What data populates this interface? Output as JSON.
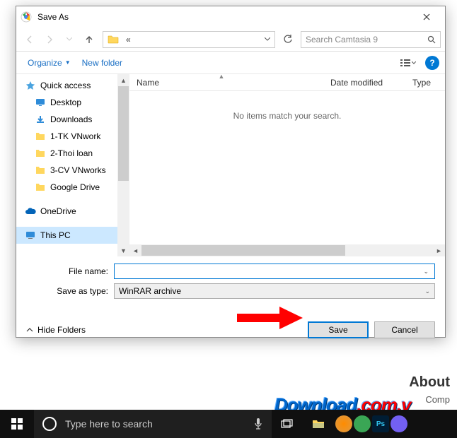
{
  "dialog": {
    "title": "Save As",
    "path_display": "«",
    "search_placeholder": "Search Camtasia 9",
    "organize_label": "Organize",
    "new_folder_label": "New folder",
    "columns": {
      "name": "Name",
      "date": "Date modified",
      "type": "Type"
    },
    "empty_message": "No items match your search.",
    "file_name_label": "File name:",
    "file_name_value": "",
    "save_type_label": "Save as type:",
    "save_type_value": "WinRAR archive",
    "hide_folders_label": "Hide Folders",
    "save_button": "Save",
    "cancel_button": "Cancel"
  },
  "nav_tree": {
    "quick_access": "Quick access",
    "desktop": "Desktop",
    "downloads": "Downloads",
    "item1": "1-TK VNwork",
    "item2": "2-Thoi loan",
    "item3": "3-CV VNworks",
    "item4": "Google Drive",
    "onedrive": "OneDrive",
    "this_pc": "This PC"
  },
  "taskbar": {
    "search_placeholder": "Type here to search"
  },
  "watermark": {
    "main": "Download",
    "ext": ".com.v"
  },
  "bg": {
    "about": "About",
    "comp": "Comp"
  }
}
